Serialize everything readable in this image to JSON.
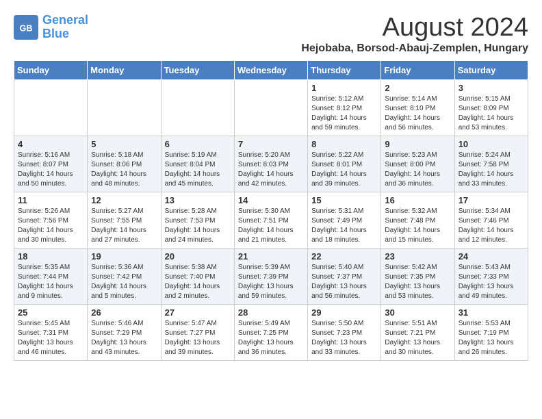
{
  "header": {
    "logo_general": "General",
    "logo_blue": "Blue",
    "month_year": "August 2024",
    "location": "Hejobaba, Borsod-Abauj-Zemplen, Hungary"
  },
  "days_of_week": [
    "Sunday",
    "Monday",
    "Tuesday",
    "Wednesday",
    "Thursday",
    "Friday",
    "Saturday"
  ],
  "weeks": [
    [
      {
        "day": "",
        "info": ""
      },
      {
        "day": "",
        "info": ""
      },
      {
        "day": "",
        "info": ""
      },
      {
        "day": "",
        "info": ""
      },
      {
        "day": "1",
        "info": "Sunrise: 5:12 AM\nSunset: 8:12 PM\nDaylight: 14 hours\nand 59 minutes."
      },
      {
        "day": "2",
        "info": "Sunrise: 5:14 AM\nSunset: 8:10 PM\nDaylight: 14 hours\nand 56 minutes."
      },
      {
        "day": "3",
        "info": "Sunrise: 5:15 AM\nSunset: 8:09 PM\nDaylight: 14 hours\nand 53 minutes."
      }
    ],
    [
      {
        "day": "4",
        "info": "Sunrise: 5:16 AM\nSunset: 8:07 PM\nDaylight: 14 hours\nand 50 minutes."
      },
      {
        "day": "5",
        "info": "Sunrise: 5:18 AM\nSunset: 8:06 PM\nDaylight: 14 hours\nand 48 minutes."
      },
      {
        "day": "6",
        "info": "Sunrise: 5:19 AM\nSunset: 8:04 PM\nDaylight: 14 hours\nand 45 minutes."
      },
      {
        "day": "7",
        "info": "Sunrise: 5:20 AM\nSunset: 8:03 PM\nDaylight: 14 hours\nand 42 minutes."
      },
      {
        "day": "8",
        "info": "Sunrise: 5:22 AM\nSunset: 8:01 PM\nDaylight: 14 hours\nand 39 minutes."
      },
      {
        "day": "9",
        "info": "Sunrise: 5:23 AM\nSunset: 8:00 PM\nDaylight: 14 hours\nand 36 minutes."
      },
      {
        "day": "10",
        "info": "Sunrise: 5:24 AM\nSunset: 7:58 PM\nDaylight: 14 hours\nand 33 minutes."
      }
    ],
    [
      {
        "day": "11",
        "info": "Sunrise: 5:26 AM\nSunset: 7:56 PM\nDaylight: 14 hours\nand 30 minutes."
      },
      {
        "day": "12",
        "info": "Sunrise: 5:27 AM\nSunset: 7:55 PM\nDaylight: 14 hours\nand 27 minutes."
      },
      {
        "day": "13",
        "info": "Sunrise: 5:28 AM\nSunset: 7:53 PM\nDaylight: 14 hours\nand 24 minutes."
      },
      {
        "day": "14",
        "info": "Sunrise: 5:30 AM\nSunset: 7:51 PM\nDaylight: 14 hours\nand 21 minutes."
      },
      {
        "day": "15",
        "info": "Sunrise: 5:31 AM\nSunset: 7:49 PM\nDaylight: 14 hours\nand 18 minutes."
      },
      {
        "day": "16",
        "info": "Sunrise: 5:32 AM\nSunset: 7:48 PM\nDaylight: 14 hours\nand 15 minutes."
      },
      {
        "day": "17",
        "info": "Sunrise: 5:34 AM\nSunset: 7:46 PM\nDaylight: 14 hours\nand 12 minutes."
      }
    ],
    [
      {
        "day": "18",
        "info": "Sunrise: 5:35 AM\nSunset: 7:44 PM\nDaylight: 14 hours\nand 9 minutes."
      },
      {
        "day": "19",
        "info": "Sunrise: 5:36 AM\nSunset: 7:42 PM\nDaylight: 14 hours\nand 5 minutes."
      },
      {
        "day": "20",
        "info": "Sunrise: 5:38 AM\nSunset: 7:40 PM\nDaylight: 14 hours\nand 2 minutes."
      },
      {
        "day": "21",
        "info": "Sunrise: 5:39 AM\nSunset: 7:39 PM\nDaylight: 13 hours\nand 59 minutes."
      },
      {
        "day": "22",
        "info": "Sunrise: 5:40 AM\nSunset: 7:37 PM\nDaylight: 13 hours\nand 56 minutes."
      },
      {
        "day": "23",
        "info": "Sunrise: 5:42 AM\nSunset: 7:35 PM\nDaylight: 13 hours\nand 53 minutes."
      },
      {
        "day": "24",
        "info": "Sunrise: 5:43 AM\nSunset: 7:33 PM\nDaylight: 13 hours\nand 49 minutes."
      }
    ],
    [
      {
        "day": "25",
        "info": "Sunrise: 5:45 AM\nSunset: 7:31 PM\nDaylight: 13 hours\nand 46 minutes."
      },
      {
        "day": "26",
        "info": "Sunrise: 5:46 AM\nSunset: 7:29 PM\nDaylight: 13 hours\nand 43 minutes."
      },
      {
        "day": "27",
        "info": "Sunrise: 5:47 AM\nSunset: 7:27 PM\nDaylight: 13 hours\nand 39 minutes."
      },
      {
        "day": "28",
        "info": "Sunrise: 5:49 AM\nSunset: 7:25 PM\nDaylight: 13 hours\nand 36 minutes."
      },
      {
        "day": "29",
        "info": "Sunrise: 5:50 AM\nSunset: 7:23 PM\nDaylight: 13 hours\nand 33 minutes."
      },
      {
        "day": "30",
        "info": "Sunrise: 5:51 AM\nSunset: 7:21 PM\nDaylight: 13 hours\nand 30 minutes."
      },
      {
        "day": "31",
        "info": "Sunrise: 5:53 AM\nSunset: 7:19 PM\nDaylight: 13 hours\nand 26 minutes."
      }
    ]
  ]
}
